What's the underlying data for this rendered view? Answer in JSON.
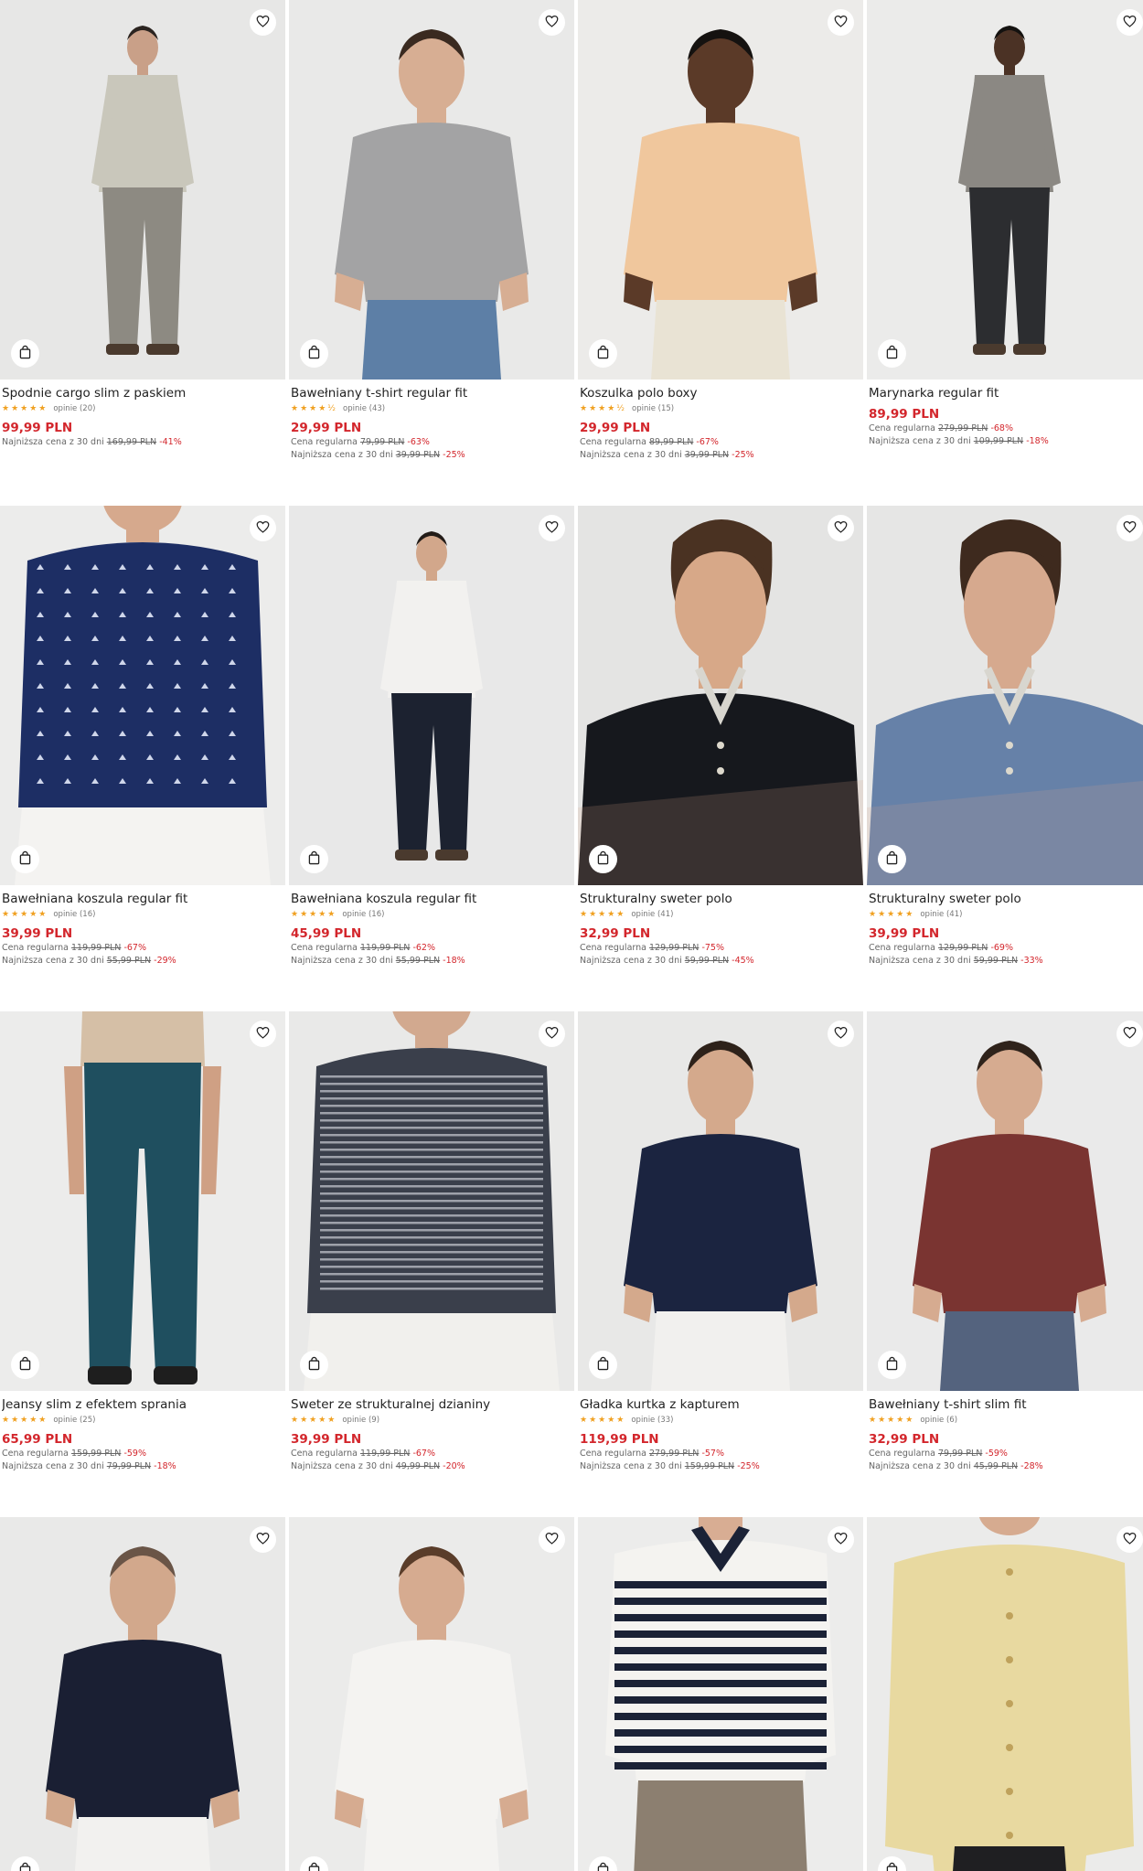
{
  "labels": {
    "reviews_prefix": "opinie",
    "regular": "Cena regularna",
    "lowest30": "Najniższa cena z 30 dni"
  },
  "icons": {
    "wishlist": "heart-icon",
    "cart": "shopping-bag-icon",
    "rating": "star-icon"
  },
  "colors": {
    "price": "#d3262c",
    "star": "#f0a020",
    "muted": "#666666"
  },
  "products": [
    {
      "title": "Spodnie cargo slim z paskiem",
      "stars": "★★★★★",
      "reviews": "opinie (20)",
      "price": "99,99 PLN",
      "regular": null,
      "lowest": {
        "label": "Najniższa cena z 30 dni",
        "old": "169,99 PLN",
        "disc": "-41%"
      },
      "palette": {
        "bg": "#e7e7e6",
        "top": "#c9c7bb",
        "bottom": "#8d8a82",
        "skin": "#c9a088",
        "hair": "#2b2420"
      },
      "shot": "full"
    },
    {
      "title": "Bawełniany t-shirt regular fit",
      "stars": "★★★★½",
      "reviews": "opinie (43)",
      "price": "29,99 PLN",
      "regular": {
        "label": "Cena regularna",
        "old": "79,99 PLN",
        "disc": "-63%"
      },
      "lowest": {
        "label": "Najniższa cena z 30 dni",
        "old": "39,99 PLN",
        "disc": "-25%"
      },
      "palette": {
        "bg": "#e9e9e8",
        "top": "#a3a3a4",
        "bottom": "#5d7fa6",
        "skin": "#d7ae93",
        "hair": "#3a2a20"
      },
      "shot": "torso"
    },
    {
      "title": "Koszulka polo boxy",
      "stars": "★★★★½",
      "reviews": "opinie (15)",
      "price": "29,99 PLN",
      "regular": {
        "label": "Cena regularna",
        "old": "89,99 PLN",
        "disc": "-67%"
      },
      "lowest": {
        "label": "Najniższa cena z 30 dni",
        "old": "39,99 PLN",
        "disc": "-25%"
      },
      "palette": {
        "bg": "#ecebe9",
        "top": "#f0c79d",
        "bottom": "#e9e3d4",
        "skin": "#5b3a28",
        "hair": "#151210"
      },
      "shot": "torso"
    },
    {
      "title": "Marynarka regular fit",
      "stars": "",
      "reviews": "",
      "price": "89,99 PLN",
      "regular": {
        "label": "Cena regularna",
        "old": "279,99 PLN",
        "disc": "-68%"
      },
      "lowest": {
        "label": "Najniższa cena z 30 dni",
        "old": "109,99 PLN",
        "disc": "-18%"
      },
      "palette": {
        "bg": "#ebebea",
        "top": "#8b8883",
        "bottom": "#2c2d30",
        "skin": "#4b3225",
        "hair": "#141210"
      },
      "shot": "full"
    },
    {
      "title": "Bawełniana koszula regular fit",
      "stars": "★★★★★",
      "reviews": "opinie (16)",
      "price": "39,99 PLN",
      "regular": {
        "label": "Cena regularna",
        "old": "119,99 PLN",
        "disc": "-67%"
      },
      "lowest": {
        "label": "Najniższa cena z 30 dni",
        "old": "55,99 PLN",
        "disc": "-29%"
      },
      "palette": {
        "bg": "#ececeb",
        "top": "#1d2e64",
        "bottom": "#f4f3f1",
        "skin": "#d6a98d",
        "hair": "#3a2a20"
      },
      "shot": "closeup"
    },
    {
      "title": "Bawełniana koszula regular fit",
      "stars": "★★★★★",
      "reviews": "opinie (16)",
      "price": "45,99 PLN",
      "regular": {
        "label": "Cena regularna",
        "old": "119,99 PLN",
        "disc": "-62%"
      },
      "lowest": {
        "label": "Najniższa cena z 30 dni",
        "old": "55,99 PLN",
        "disc": "-18%"
      },
      "palette": {
        "bg": "#e8e8e8",
        "top": "#f2f1ef",
        "bottom": "#1c2230",
        "skin": "#d2a78b",
        "hair": "#231c18"
      },
      "shot": "full"
    },
    {
      "title": "Strukturalny sweter polo",
      "stars": "★★★★★",
      "reviews": "opinie (41)",
      "price": "32,99 PLN",
      "regular": {
        "label": "Cena regularna",
        "old": "129,99 PLN",
        "disc": "-75%"
      },
      "lowest": {
        "label": "Najniższa cena z 30 dni",
        "old": "59,99 PLN",
        "disc": "-45%"
      },
      "palette": {
        "bg": "#e4e4e3",
        "top": "#16181d",
        "bottom": "#16181d",
        "skin": "#d7a888",
        "hair": "#4a3222"
      },
      "shot": "portrait"
    },
    {
      "title": "Strukturalny sweter polo",
      "stars": "★★★★★",
      "reviews": "opinie (41)",
      "price": "39,99 PLN",
      "regular": {
        "label": "Cena regularna",
        "old": "129,99 PLN",
        "disc": "-69%"
      },
      "lowest": {
        "label": "Najniższa cena z 30 dni",
        "old": "59,99 PLN",
        "disc": "-33%"
      },
      "palette": {
        "bg": "#e6e6e5",
        "top": "#6681a8",
        "bottom": "#6681a8",
        "skin": "#d6a98e",
        "hair": "#3e2a1e"
      },
      "shot": "portrait"
    },
    {
      "title": "Jeansy slim z efektem sprania",
      "stars": "★★★★★",
      "reviews": "opinie (25)",
      "price": "65,99 PLN",
      "regular": {
        "label": "Cena regularna",
        "old": "159,99 PLN",
        "disc": "-59%"
      },
      "lowest": {
        "label": "Najniższa cena z 30 dni",
        "old": "79,99 PLN",
        "disc": "-18%"
      },
      "palette": {
        "bg": "#ececeb",
        "top": "#d5bfa6",
        "bottom": "#1f4f5f",
        "skin": "#cfa084",
        "hair": "#2a2420"
      },
      "shot": "legs"
    },
    {
      "title": "Sweter ze strukturalnej dzianiny",
      "stars": "★★★★★",
      "reviews": "opinie (9)",
      "price": "39,99 PLN",
      "regular": {
        "label": "Cena regularna",
        "old": "119,99 PLN",
        "disc": "-67%"
      },
      "lowest": {
        "label": "Najniższa cena z 30 dni",
        "old": "49,99 PLN",
        "disc": "-20%"
      },
      "palette": {
        "bg": "#e9e9e8",
        "top": "#3a3f4b",
        "bottom": "#f1f0ed",
        "skin": "#d2a98f",
        "hair": "#3a2a20"
      },
      "shot": "closeup"
    },
    {
      "title": "Gładka kurtka z kapturem",
      "stars": "★★★★★",
      "reviews": "opinie (33)",
      "price": "119,99 PLN",
      "regular": {
        "label": "Cena regularna",
        "old": "279,99 PLN",
        "disc": "-57%"
      },
      "lowest": {
        "label": "Najniższa cena z 30 dni",
        "old": "159,99 PLN",
        "disc": "-25%"
      },
      "palette": {
        "bg": "#e8e8e7",
        "top": "#1b2440",
        "bottom": "#f1f0ee",
        "skin": "#d4a98c",
        "hair": "#2e221a"
      },
      "shot": "torso"
    },
    {
      "title": "Bawełniany t-shirt slim fit",
      "stars": "★★★★★",
      "reviews": "opinie (6)",
      "price": "32,99 PLN",
      "regular": {
        "label": "Cena regularna",
        "old": "79,99 PLN",
        "disc": "-59%"
      },
      "lowest": {
        "label": "Najniższa cena z 30 dni",
        "old": "45,99 PLN",
        "disc": "-28%"
      },
      "palette": {
        "bg": "#eaeaea",
        "top": "#7a3431",
        "bottom": "#54637e",
        "skin": "#d6ab90",
        "hair": "#2f231b"
      },
      "shot": "torso"
    },
    {
      "title": "",
      "stars": "",
      "reviews": "",
      "price": "",
      "regular": null,
      "lowest": null,
      "palette": {
        "bg": "#e9e9e8",
        "top": "#1a1f33",
        "bottom": "#f2f1ef",
        "skin": "#d2a88c",
        "hair": "#6a5547"
      },
      "shot": "torso"
    },
    {
      "title": "",
      "stars": "",
      "reviews": "",
      "price": "",
      "regular": null,
      "lowest": null,
      "palette": {
        "bg": "#ebebea",
        "top": "#f4f3f1",
        "bottom": "#f4f3f1",
        "skin": "#d6ab90",
        "hair": "#5a3d2a"
      },
      "shot": "torso"
    },
    {
      "title": "",
      "stars": "",
      "reviews": "",
      "price": "",
      "regular": null,
      "lowest": null,
      "palette": {
        "bg": "#ececeb",
        "top": "#f4f3f0",
        "bottom": "#8c7f70",
        "skin": "#d8ad93",
        "hair": "#3a2a20"
      },
      "shot": "stripes"
    },
    {
      "title": "",
      "stars": "",
      "reviews": "",
      "price": "",
      "regular": null,
      "lowest": null,
      "palette": {
        "bg": "#ebebea",
        "top": "#e8d9a0",
        "bottom": "#1f1f22",
        "skin": "#d6ab90",
        "hair": "#3a2a20"
      },
      "shot": "shirt"
    }
  ]
}
